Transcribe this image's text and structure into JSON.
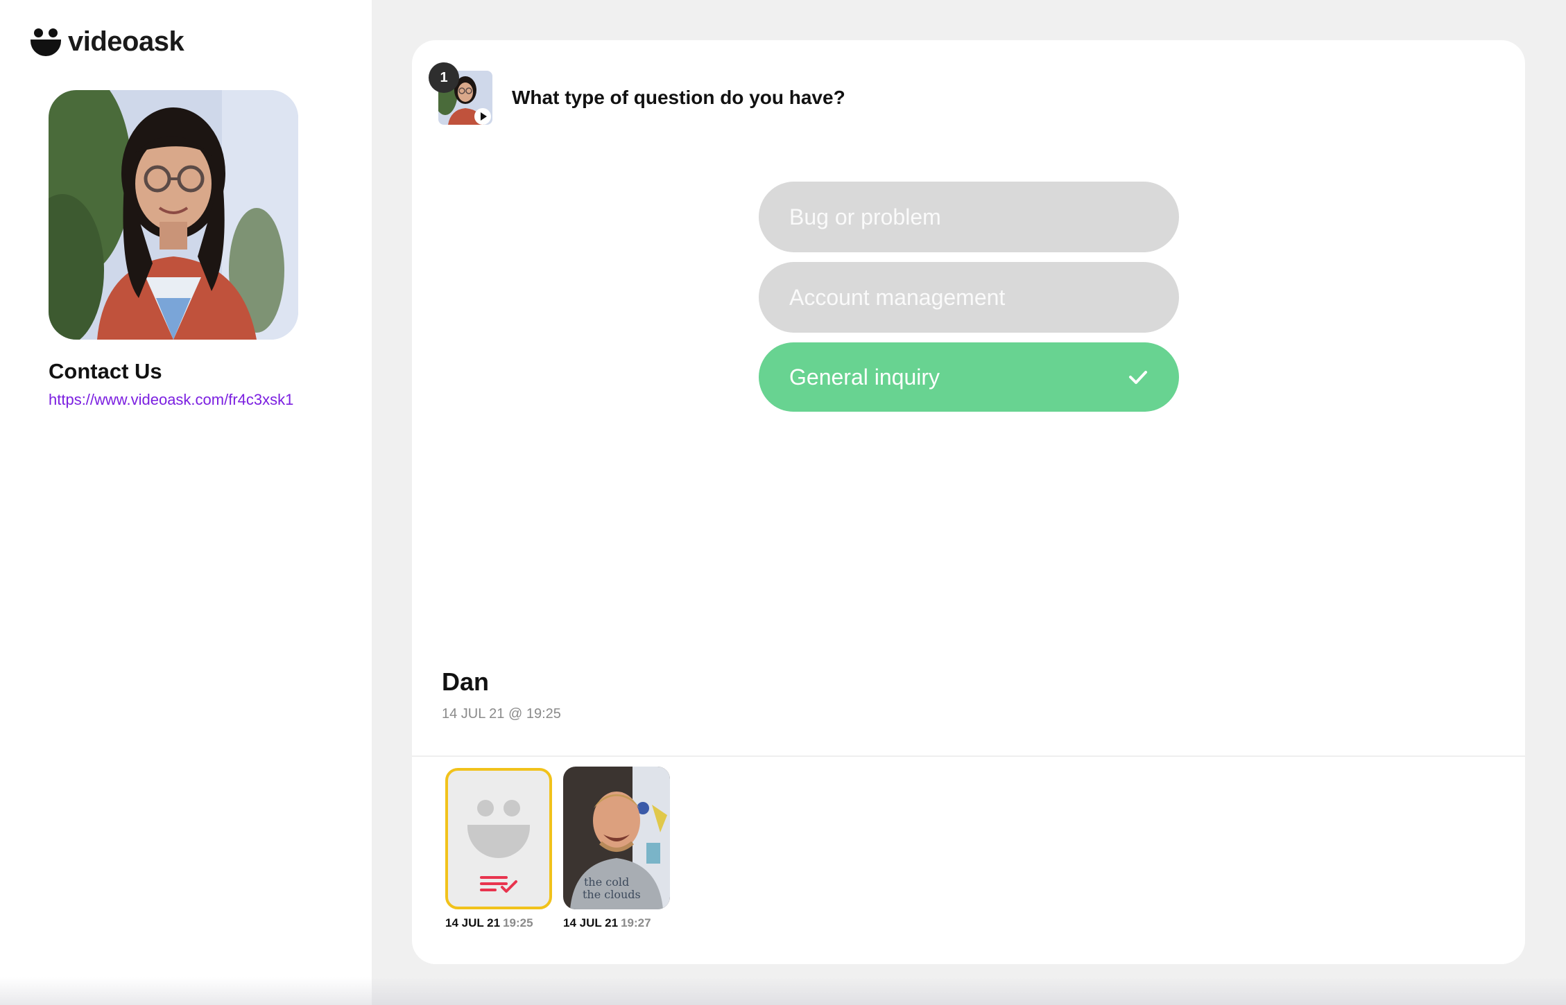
{
  "brand": {
    "name": "videoask"
  },
  "sidebar": {
    "title": "Contact Us",
    "link": "https://www.videoask.com/fr4c3xsk1"
  },
  "step": {
    "number": "1",
    "question": "What type of question do you have?"
  },
  "options": [
    {
      "label": "Bug or problem",
      "selected": false
    },
    {
      "label": "Account management",
      "selected": false
    },
    {
      "label": "General inquiry",
      "selected": true
    }
  ],
  "responder": {
    "name": "Dan",
    "date": "14 JUL 21 @ 19:25"
  },
  "answers": [
    {
      "type": "text",
      "date": "14 JUL 21",
      "time": "19:25"
    },
    {
      "type": "video",
      "date": "14 JUL 21",
      "time": "19:27"
    }
  ],
  "colors": {
    "accent_green": "#68d391",
    "link_purple": "#7b1fe0",
    "highlight_yellow": "#f1c21b",
    "text_answer_icon": "#e8344e"
  }
}
